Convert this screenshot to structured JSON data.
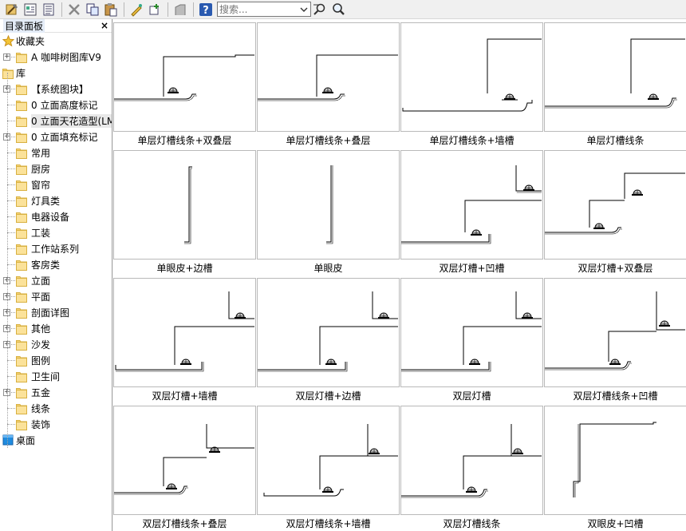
{
  "toolbar": {
    "search_placeholder": "搜索...",
    "buttons": [
      {
        "name": "insert-block-button",
        "icon": "hammer-icon"
      },
      {
        "name": "block-manager-button",
        "icon": "form-icon"
      },
      {
        "name": "list-view-button",
        "icon": "list-icon"
      },
      {
        "name": "delete-button",
        "icon": "x-icon"
      },
      {
        "name": "copy-button",
        "icon": "copy-icon"
      },
      {
        "name": "paste-button",
        "icon": "paste-icon"
      },
      {
        "name": "edit-button",
        "icon": "pen-icon"
      },
      {
        "name": "add-button",
        "icon": "add-icon"
      },
      {
        "name": "shape-button",
        "icon": "shape-icon"
      },
      {
        "name": "help-button",
        "icon": "help-icon"
      },
      {
        "name": "search-go-button",
        "icon": "search-go-icon"
      },
      {
        "name": "zoom-button",
        "icon": "magnifier-icon"
      }
    ]
  },
  "panel": {
    "title": "目录面板",
    "close": "×"
  },
  "tree": [
    {
      "label": "收藏夹",
      "level": 0,
      "icon": "star-icon",
      "toggle": ""
    },
    {
      "label": "A 咖啡树图库V9",
      "level": 1,
      "icon": "folder-icon",
      "toggle": "+"
    },
    {
      "label": "库",
      "level": 0,
      "icon": "folder-icon",
      "toggle": ""
    },
    {
      "label": "【系统图块】",
      "level": 1,
      "icon": "folder-icon",
      "toggle": "+"
    },
    {
      "label": "0 立面高度标记",
      "level": 1,
      "icon": "folder-icon",
      "toggle": ""
    },
    {
      "label": "0 立面天花造型(LM",
      "level": 1,
      "icon": "folder-icon",
      "toggle": "",
      "selected": true
    },
    {
      "label": "0 立面填充标记",
      "level": 1,
      "icon": "folder-icon",
      "toggle": "+"
    },
    {
      "label": "常用",
      "level": 1,
      "icon": "folder-icon",
      "toggle": ""
    },
    {
      "label": "厨房",
      "level": 1,
      "icon": "folder-icon",
      "toggle": ""
    },
    {
      "label": "窗帘",
      "level": 1,
      "icon": "folder-icon",
      "toggle": ""
    },
    {
      "label": "灯具类",
      "level": 1,
      "icon": "folder-icon",
      "toggle": ""
    },
    {
      "label": "电器设备",
      "level": 1,
      "icon": "folder-icon",
      "toggle": ""
    },
    {
      "label": "工装",
      "level": 1,
      "icon": "folder-icon",
      "toggle": ""
    },
    {
      "label": "工作站系列",
      "level": 1,
      "icon": "folder-icon",
      "toggle": ""
    },
    {
      "label": "客房类",
      "level": 1,
      "icon": "folder-icon",
      "toggle": ""
    },
    {
      "label": "立面",
      "level": 1,
      "icon": "folder-icon",
      "toggle": "+"
    },
    {
      "label": "平面",
      "level": 1,
      "icon": "folder-icon",
      "toggle": "+"
    },
    {
      "label": "剖面详图",
      "level": 1,
      "icon": "folder-icon",
      "toggle": "+"
    },
    {
      "label": "其他",
      "level": 1,
      "icon": "folder-icon",
      "toggle": "+"
    },
    {
      "label": "沙发",
      "level": 1,
      "icon": "folder-icon",
      "toggle": "+"
    },
    {
      "label": "图例",
      "level": 1,
      "icon": "folder-icon",
      "toggle": ""
    },
    {
      "label": "卫生间",
      "level": 1,
      "icon": "folder-icon",
      "toggle": ""
    },
    {
      "label": "五金",
      "level": 1,
      "icon": "folder-icon",
      "toggle": "+"
    },
    {
      "label": "线条",
      "level": 1,
      "icon": "folder-icon",
      "toggle": ""
    },
    {
      "label": "装饰",
      "level": 1,
      "icon": "folder-icon",
      "toggle": ""
    },
    {
      "label": "桌面",
      "level": 0,
      "icon": "desktop-icon",
      "toggle": ""
    }
  ],
  "items": [
    {
      "caption": "单层灯槽线条+双叠层",
      "shape": "single-double"
    },
    {
      "caption": "单层灯槽线条+叠层",
      "shape": "single-layer"
    },
    {
      "caption": "单层灯槽线条+墙槽",
      "shape": "single-wall"
    },
    {
      "caption": "单层灯槽线条",
      "shape": "single"
    },
    {
      "caption": "单眼皮+边槽",
      "shape": "eyelid-edge"
    },
    {
      "caption": "单眼皮",
      "shape": "eyelid"
    },
    {
      "caption": "双层灯槽+凹槽",
      "shape": "double-recess"
    },
    {
      "caption": "双层灯槽+双叠层",
      "shape": "double-double"
    },
    {
      "caption": "双层灯槽+墙槽",
      "shape": "double-wall"
    },
    {
      "caption": "双层灯槽+边槽",
      "shape": "double-edge"
    },
    {
      "caption": "双层灯槽",
      "shape": "double"
    },
    {
      "caption": "双层灯槽线条+凹槽",
      "shape": "double-line-recess"
    },
    {
      "caption": "双层灯槽线条+叠层",
      "shape": "double-line-layer"
    },
    {
      "caption": "双层灯槽线条+墙槽",
      "shape": "double-line-wall"
    },
    {
      "caption": "双层灯槽线条",
      "shape": "double-line"
    },
    {
      "caption": "双眼皮+凹槽",
      "shape": "double-eyelid"
    }
  ]
}
